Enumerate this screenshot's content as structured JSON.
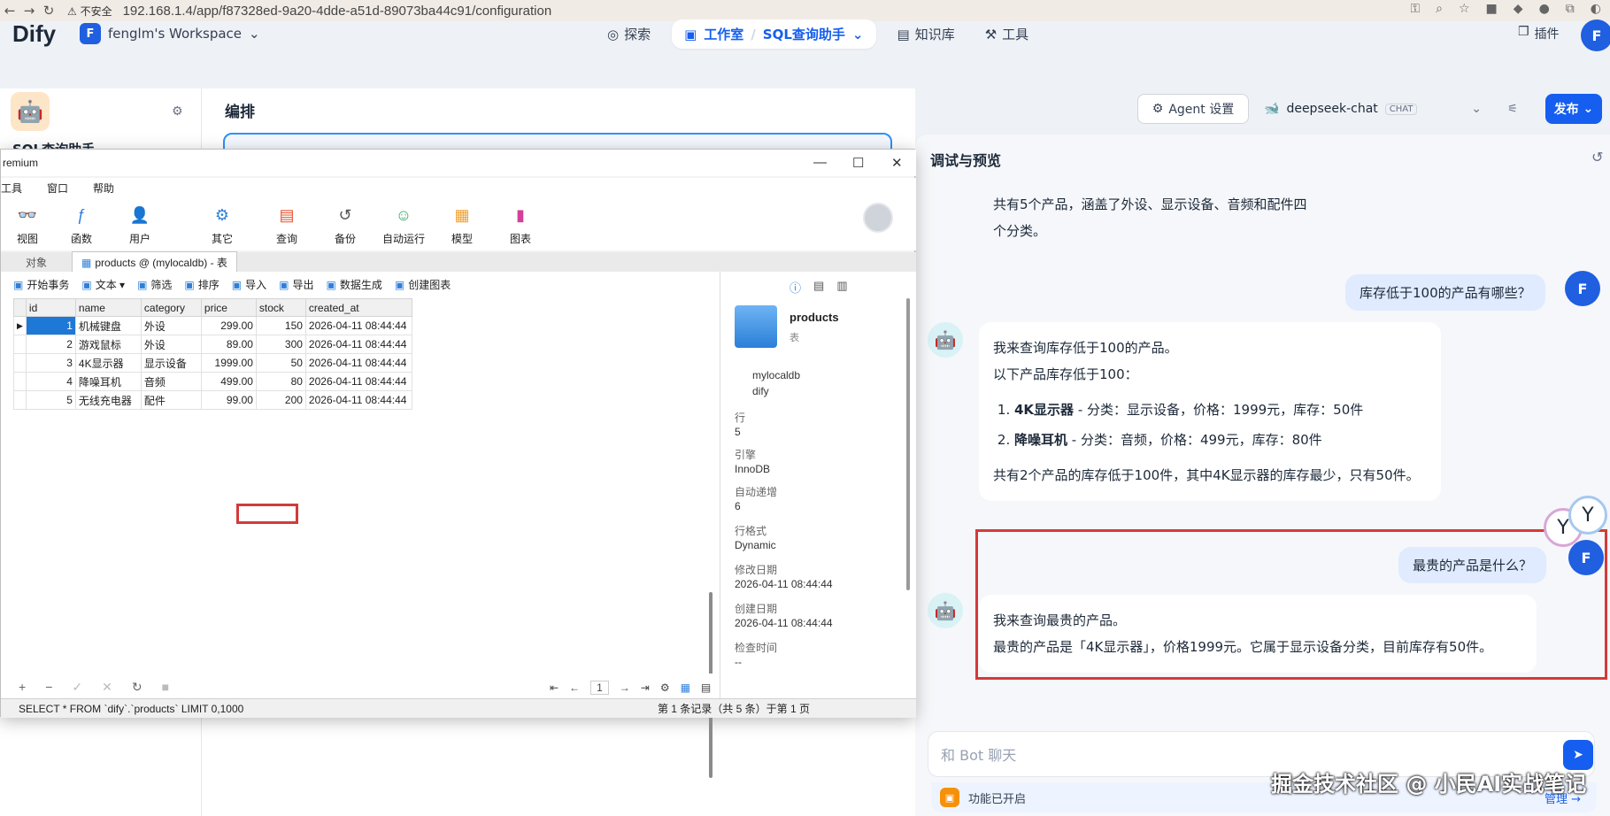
{
  "browser": {
    "insecure_label": "不安全",
    "url": "192.168.1.4/app/f87328ed-9a20-4dde-a51d-89073ba44c91/configuration"
  },
  "header": {
    "logo": "Dify",
    "workspace_initial": "F",
    "workspace": "fenglm's Workspace",
    "nav_explore": "探索",
    "nav_studio": "工作室",
    "nav_app": "SQL查询助手",
    "nav_knowledge": "知识库",
    "nav_tools": "工具",
    "plugins": "插件",
    "avatar": "F"
  },
  "sidebar": {
    "app_title": "SQL查询助手"
  },
  "orchestrate": {
    "title": "编排"
  },
  "toolbar": {
    "agent_settings": "Agent 设置",
    "model": "deepseek-chat",
    "model_badge": "CHAT",
    "publish": "发布"
  },
  "debug": {
    "title": "调试与预览",
    "msg0": "共有5个产品，涵盖了外设、显示设备、音频和配件四个分类。",
    "user1": "库存低于100的产品有哪些？",
    "bot1_intro": "我来查询库存低于100的产品。",
    "bot1_sub": "以下产品库存低于100：",
    "bot1_items": [
      {
        "name": "4K显示器",
        "detail": " - 分类：显示设备，价格：1999元，库存：50件"
      },
      {
        "name": "降噪耳机",
        "detail": " - 分类：音频，价格：499元，库存：80件"
      }
    ],
    "bot1_summary": "共有2个产品的库存低于100件，其中4K显示器的库存最少，只有50件。",
    "user2": "最贵的产品是什么？",
    "bot2_line1": "我来查询最贵的产品。",
    "bot2_line2": "最贵的产品是「4K显示器」，价格1999元。它属于显示设备分类，目前库存有50件。",
    "input_placeholder": "和 Bot 聊天",
    "feature_text": "功能已开启",
    "manage": "管理",
    "user_initial": "F"
  },
  "watermark": "掘金技术社区 @ 小民AI实战笔记",
  "navicat": {
    "title_fragment": "remium",
    "menu": [
      "工具",
      "窗口",
      "帮助"
    ],
    "tools": [
      {
        "label": "视图",
        "icon": "view-icon",
        "color": "#2f7fd8"
      },
      {
        "label": "函数",
        "icon": "function-icon",
        "color": "#2f7fd8"
      },
      {
        "label": "用户",
        "icon": "user-icon",
        "color": "#e48a2a"
      },
      {
        "label": "其它",
        "icon": "other-icon",
        "color": "#2f7fd8"
      },
      {
        "label": "查询",
        "icon": "query-icon",
        "color": "#e5502f"
      },
      {
        "label": "备份",
        "icon": "backup-icon",
        "color": "#555555"
      },
      {
        "label": "自动运行",
        "icon": "robot-icon",
        "color": "#3aa66a"
      },
      {
        "label": "模型",
        "icon": "model-icon",
        "color": "#f0a030"
      },
      {
        "label": "图表",
        "icon": "chart-icon",
        "color": "#d2409a"
      }
    ],
    "tab_objects": "对象",
    "tab_table": "products @   (mylocaldb) - 表",
    "actions": [
      "开始事务",
      "文本 ▾",
      "筛选",
      "排序",
      "导入",
      "导出",
      "数据生成",
      "创建图表"
    ],
    "columns": [
      "id",
      "name",
      "category",
      "price",
      "stock",
      "created_at"
    ],
    "rows": [
      [
        "1",
        "机械键盘",
        "外设",
        "299.00",
        "150",
        "2026-04-11 08:44:44"
      ],
      [
        "2",
        "游戏鼠标",
        "外设",
        "89.00",
        "300",
        "2026-04-11 08:44:44"
      ],
      [
        "3",
        "4K显示器",
        "显示设备",
        "1999.00",
        "50",
        "2026-04-11 08:44:44"
      ],
      [
        "4",
        "降噪耳机",
        "音频",
        "499.00",
        "80",
        "2026-04-11 08:44:44"
      ],
      [
        "5",
        "无线充电器",
        "配件",
        "99.00",
        "200",
        "2026-04-11 08:44:44"
      ]
    ],
    "info": {
      "name": "products",
      "kind": "表",
      "db": "mylocaldb",
      "schema": "dify",
      "rows_lbl": "行",
      "rows_val": "5",
      "engine_lbl": "引擎",
      "engine_val": "InnoDB",
      "ai_lbl": "自动递增",
      "ai_val": "6",
      "fmt_lbl": "行格式",
      "fmt_val": "Dynamic",
      "mod_lbl": "修改日期",
      "mod_val": "2026-04-11 08:44:44",
      "cre_lbl": "创建日期",
      "cre_val": "2026-04-11 08:44:44",
      "chk_lbl": "检查时间",
      "chk_val": "--"
    },
    "page": "1",
    "status_sql": "SELECT * FROM `dify`.`products` LIMIT 0,1000",
    "status_rec": "第 1 条记录（共 5 条）于第 1 页"
  }
}
